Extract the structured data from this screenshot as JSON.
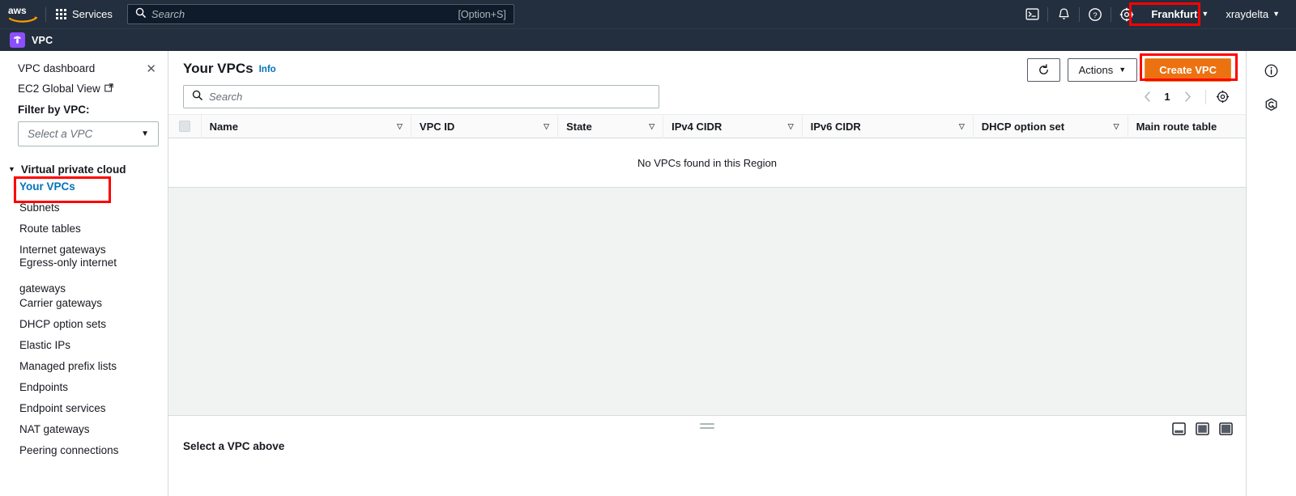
{
  "topnav": {
    "logo_alt": "aws",
    "services_label": "Services",
    "search_placeholder": "Search",
    "search_value": "",
    "search_shortcut": "[Option+S]",
    "icons": [
      {
        "name": "cloudshell-icon",
        "glyph": ">_"
      },
      {
        "name": "notifications-bell-icon",
        "glyph": "bell"
      },
      {
        "name": "help-question-icon",
        "glyph": "?"
      },
      {
        "name": "settings-gear-icon",
        "glyph": "gear"
      }
    ],
    "region": "Frankfurt",
    "account": "xraydelta",
    "caret": "▼"
  },
  "servicebar": {
    "service_name": "VPC",
    "badge_color": "#8c4fff"
  },
  "sidebar": {
    "title": "VPC dashboard",
    "close_label": "✕",
    "global_view_label": "EC2 Global View",
    "filter_label": "Filter by VPC:",
    "filter_placeholder": "Select a VPC",
    "filter_value": "",
    "group_label": "Virtual private cloud",
    "group_caret": "▼",
    "items": [
      {
        "label": "Your VPCs",
        "active": true
      },
      {
        "label": "Subnets",
        "active": false
      },
      {
        "label": "Route tables",
        "active": false
      },
      {
        "label": "Internet gateways",
        "active": false
      },
      {
        "label": "Egress-only internet gateways",
        "active": false
      },
      {
        "label": "Carrier gateways",
        "active": false
      },
      {
        "label": "DHCP option sets",
        "active": false
      },
      {
        "label": "Elastic IPs",
        "active": false
      },
      {
        "label": "Managed prefix lists",
        "active": false
      },
      {
        "label": "Endpoints",
        "active": false
      },
      {
        "label": "Endpoint services",
        "active": false
      },
      {
        "label": "NAT gateways",
        "active": false
      },
      {
        "label": "Peering connections",
        "active": false
      }
    ],
    "egress_line1": "Egress-only internet",
    "egress_line2": "gateways"
  },
  "main": {
    "page_title": "Your VPCs",
    "info_label": "Info",
    "refresh_label": "↻",
    "actions_label": "Actions",
    "create_label": "Create VPC",
    "search_placeholder": "Search",
    "search_value": "",
    "pagination": {
      "prev": "‹",
      "page": "1",
      "next": "›"
    },
    "table": {
      "columns": [
        "Name",
        "VPC ID",
        "State",
        "IPv4 CIDR",
        "IPv6 CIDR",
        "DHCP option set",
        "Main route table"
      ],
      "sort_glyph": "▽",
      "rows": [],
      "empty_message": "No VPCs found in this Region"
    }
  },
  "split_panel": {
    "title": "Select a VPC above",
    "layout_icons": [
      "split-bottom-icon",
      "split-side-icon",
      "split-full-icon"
    ]
  },
  "right_rail": {
    "icons": [
      {
        "name": "info-circle-icon",
        "glyph": "i"
      },
      {
        "name": "shortcuts-hexagon-icon",
        "glyph": "hex"
      }
    ]
  },
  "annotations": {
    "color": "#ff0000",
    "highlighted": [
      "Frankfurt",
      "Create VPC",
      "Your VPCs"
    ]
  }
}
